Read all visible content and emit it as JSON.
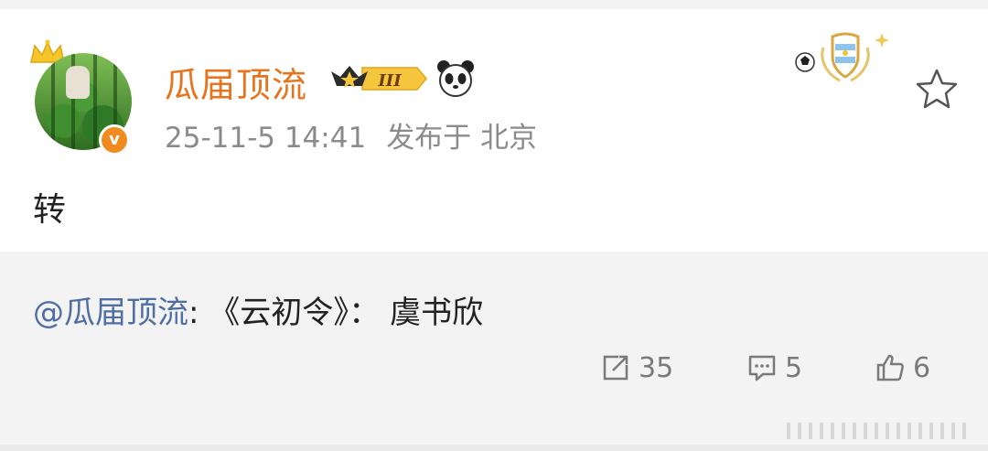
{
  "post": {
    "username": "瓜届顶流",
    "level": "III",
    "timestamp": "25-11-5 14:41",
    "location": "发布于 北京",
    "text": "转"
  },
  "quoted": {
    "mention": "@瓜届顶流",
    "content": ": 《云初令》： 虞书欣"
  },
  "actions": {
    "repost_count": "35",
    "comment_count": "5",
    "like_count": "6"
  },
  "colors": {
    "username": "#e8731d",
    "mention": "#4f6ea3",
    "verified_badge": "#f08c1f"
  },
  "icons": [
    "crown-icon",
    "verified-v-icon",
    "level-badge-icon",
    "panda-icon",
    "football-medal-icon",
    "star-icon",
    "repost-icon",
    "comment-icon",
    "like-icon"
  ]
}
